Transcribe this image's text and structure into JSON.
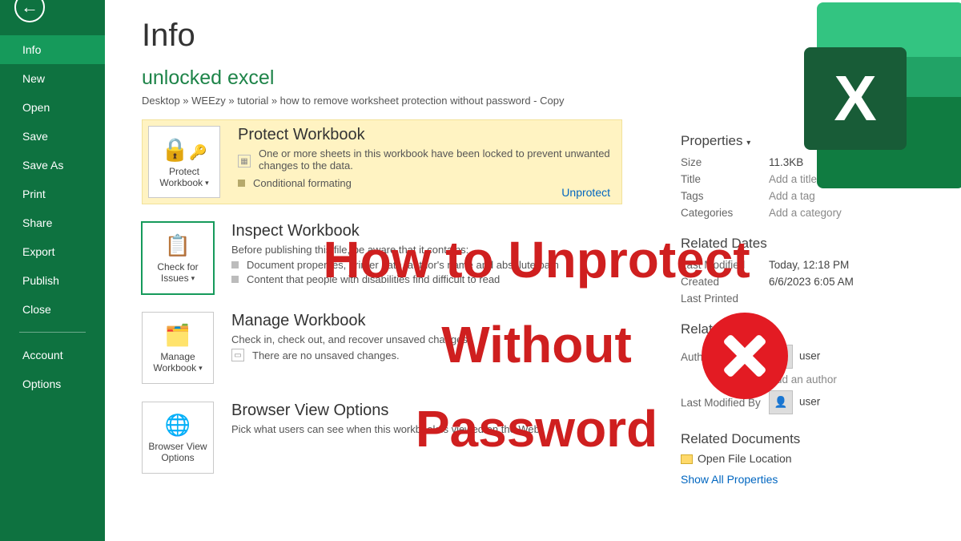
{
  "sidebar": {
    "items": [
      {
        "label": "Info",
        "active": true
      },
      {
        "label": "New"
      },
      {
        "label": "Open"
      },
      {
        "label": "Save"
      },
      {
        "label": "Save As"
      },
      {
        "label": "Print"
      },
      {
        "label": "Share"
      },
      {
        "label": "Export"
      },
      {
        "label": "Publish"
      },
      {
        "label": "Close"
      }
    ],
    "footer": [
      {
        "label": "Account"
      },
      {
        "label": "Options"
      }
    ]
  },
  "header": {
    "title": "Info",
    "docname": "unlocked excel",
    "breadcrumbs": "Desktop » WEEzy » tutorial » how to remove worksheet protection without password - Copy"
  },
  "blocks": {
    "protect": {
      "tile": "Protect Workbook",
      "title": "Protect Workbook",
      "desc": "One or more sheets in this workbook have been locked to prevent unwanted changes to the data.",
      "item": "Conditional formating",
      "unprotect": "Unprotect"
    },
    "inspect": {
      "tile": "Check for Issues",
      "title": "Inspect Workbook",
      "desc": "Before publishing this file, be aware that it contains:",
      "item1": "Document properties, printer path, author's name and absolute path",
      "item2": "Content that people with disabilities find difficult to read"
    },
    "manage": {
      "tile": "Manage Workbook",
      "title": "Manage Workbook",
      "desc": "Check in, check out, and recover unsaved changes.",
      "item": "There are no unsaved changes."
    },
    "browser": {
      "tile": "Browser View Options",
      "title": "Browser View Options",
      "desc": "Pick what users can see when this workbook is viewed on the Web."
    }
  },
  "right": {
    "props_head": "Properties",
    "size_l": "Size",
    "size_v": "11.3KB",
    "title_l": "Title",
    "title_v": "Add a title",
    "tags_l": "Tags",
    "tags_v": "Add a tag",
    "cats_l": "Categories",
    "cats_v": "Add a category",
    "dates_head": "Related Dates",
    "mod_l": "Last Modified",
    "mod_v": "Today, 12:18 PM",
    "cre_l": "Created",
    "cre_v": "6/6/2023 6:05 AM",
    "prt_l": "Last Printed",
    "people_head": "Related People",
    "auth_l": "Author",
    "auth_v": "user",
    "auth_add": "Add an author",
    "lmb_l": "Last Modified By",
    "lmb_v": "user",
    "docs_head": "Related Documents",
    "open_loc": "Open File Location",
    "show_all": "Show All Properties"
  },
  "overlay": {
    "line1": "How to Unprotect",
    "line2": "Without",
    "line3": "Password"
  }
}
